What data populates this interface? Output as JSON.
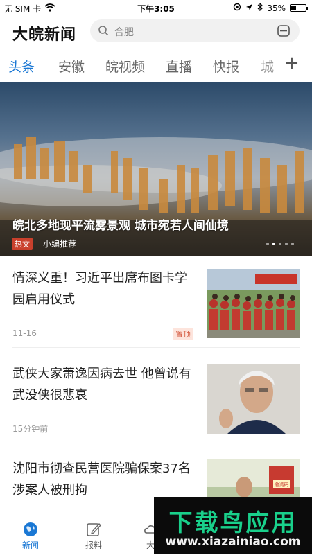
{
  "status_bar": {
    "carrier": "无 SIM 卡",
    "time": "下午3:05",
    "battery_text": "35%",
    "battery_level": 0.35
  },
  "header": {
    "app_title": "大皖新闻",
    "search_placeholder": "合肥"
  },
  "tabs": [
    {
      "label": "头条",
      "active": true
    },
    {
      "label": "安徽"
    },
    {
      "label": "皖视频"
    },
    {
      "label": "直播"
    },
    {
      "label": "快报"
    },
    {
      "label": "城"
    }
  ],
  "tabs_more": "+",
  "hero": {
    "title": "皖北多地现平流雾景观 城市宛若人间仙境",
    "tag": "热文",
    "source": "小编推荐",
    "slide_count": 5,
    "active_slide": 1
  },
  "news": [
    {
      "title": "情深义重！习近平出席布图卡学园启用仪式",
      "time": "11-16",
      "badge": "置顶"
    },
    {
      "title": "武侠大家萧逸因病去世 他曾说有武没侠很悲哀",
      "time": "15分钟前",
      "badge": ""
    },
    {
      "title": "沈阳市彻查民营医院骗保案37名涉案人被刑拘",
      "time": "",
      "badge": ""
    }
  ],
  "thumb3_sign": "邀请码",
  "bottom_nav": [
    {
      "label": "新闻",
      "icon": "globe-icon",
      "active": true
    },
    {
      "label": "报料",
      "icon": "edit-icon"
    },
    {
      "label": "大",
      "icon": "cloud-icon"
    }
  ],
  "watermark": {
    "text": "下载鸟应用",
    "url": "www.xiazainiao.com"
  },
  "colors": {
    "accent": "#1b78d4",
    "hot_tag": "#c9402c",
    "top_badge": "#d4593f",
    "watermark_green": "#19d08b"
  }
}
